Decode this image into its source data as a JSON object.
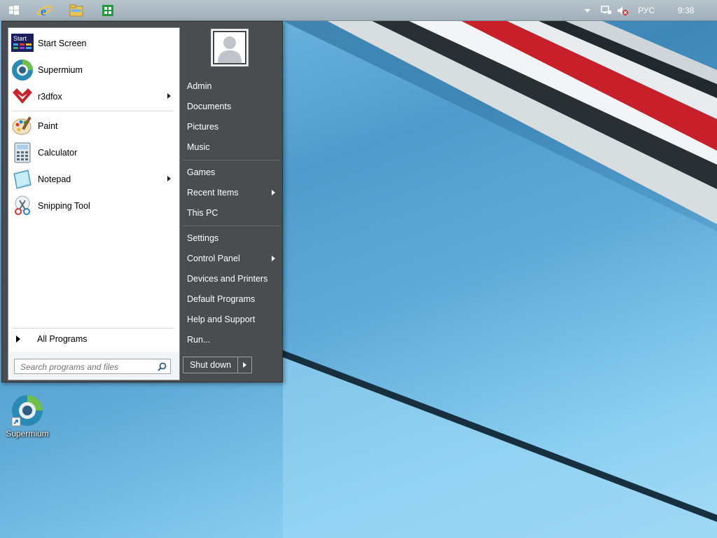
{
  "taskbar": {
    "pinned": [
      "windows-start-icon",
      "internet-explorer-icon",
      "file-explorer-icon",
      "store-icon"
    ],
    "tray": {
      "language": "РУС",
      "clock": "9:38"
    }
  },
  "start_menu": {
    "programs": [
      {
        "label": "Start Screen",
        "icon": "start-screen-icon",
        "icon_text": "Start",
        "submenu": false
      },
      {
        "label": "Supermium",
        "icon": "supermium-icon",
        "submenu": false
      },
      {
        "label": "r3dfox",
        "icon": "r3dfox-icon",
        "submenu": true
      },
      {
        "label": "Paint",
        "icon": "paint-icon",
        "submenu": false
      },
      {
        "label": "Calculator",
        "icon": "calculator-icon",
        "submenu": false
      },
      {
        "label": "Notepad",
        "icon": "notepad-icon",
        "submenu": true
      },
      {
        "label": "Snipping Tool",
        "icon": "snipping-tool-icon",
        "submenu": false
      }
    ],
    "all_programs": "All Programs",
    "search_placeholder": "Search programs and files",
    "right_items": [
      {
        "label": "Admin",
        "submenu": false
      },
      {
        "label": "Documents",
        "submenu": false
      },
      {
        "label": "Pictures",
        "submenu": false
      },
      {
        "label": "Music",
        "submenu": false
      },
      {
        "label": "Games",
        "submenu": false
      },
      {
        "label": "Recent Items",
        "submenu": true
      },
      {
        "label": "This PC",
        "submenu": false
      },
      {
        "label": "Settings",
        "submenu": false
      },
      {
        "label": "Control Panel",
        "submenu": true
      },
      {
        "label": "Devices and Printers",
        "submenu": false
      },
      {
        "label": "Default Programs",
        "submenu": false
      },
      {
        "label": "Help and Support",
        "submenu": false
      },
      {
        "label": "Run...",
        "submenu": false
      }
    ],
    "shutdown_label": "Shut down"
  },
  "desktop": {
    "icons": [
      {
        "label": "Supermium",
        "icon": "supermium-icon"
      }
    ]
  },
  "colors": {
    "menu_dark": "#4a4d4f",
    "desktop_blue": "#5aa8d6",
    "stripe_red": "#c8202a"
  }
}
